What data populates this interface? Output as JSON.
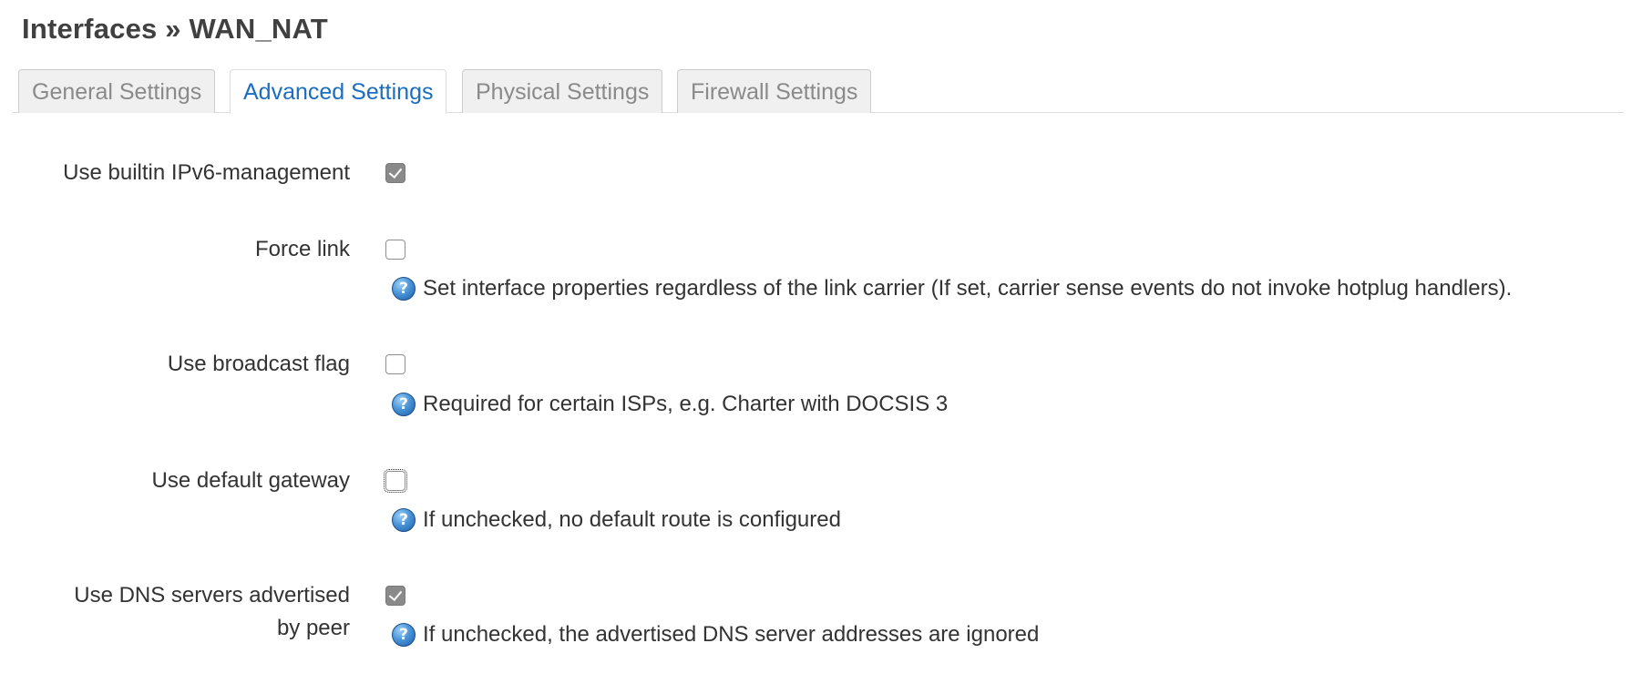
{
  "header": {
    "title": "Interfaces » WAN_NAT"
  },
  "tabs": [
    {
      "label": "General Settings",
      "active": false
    },
    {
      "label": "Advanced Settings",
      "active": true
    },
    {
      "label": "Physical Settings",
      "active": false
    },
    {
      "label": "Firewall Settings",
      "active": false
    }
  ],
  "fields": {
    "ipv6_management": {
      "label": "Use builtin IPv6-management",
      "checked": true
    },
    "force_link": {
      "label": "Force link",
      "checked": false,
      "hint": "Set interface properties regardless of the link carrier (If set, carrier sense events do not invoke hotplug handlers)."
    },
    "broadcast_flag": {
      "label": "Use broadcast flag",
      "checked": false,
      "hint": "Required for certain ISPs, e.g. Charter with DOCSIS 3"
    },
    "default_gateway": {
      "label": "Use default gateway",
      "checked": false,
      "hint": "If unchecked, no default route is configured"
    },
    "peer_dns": {
      "label_line1": "Use DNS servers advertised",
      "label_line2": "by peer",
      "checked": true,
      "hint": "If unchecked, the advertised DNS server addresses are ignored"
    }
  },
  "icons": {
    "help": "help-icon",
    "help_glyph": "?"
  },
  "colors": {
    "active_tab_text": "#1a6dc0",
    "inactive_tab_text": "#8a8a8a",
    "checked_box": "#8a8a8a"
  }
}
